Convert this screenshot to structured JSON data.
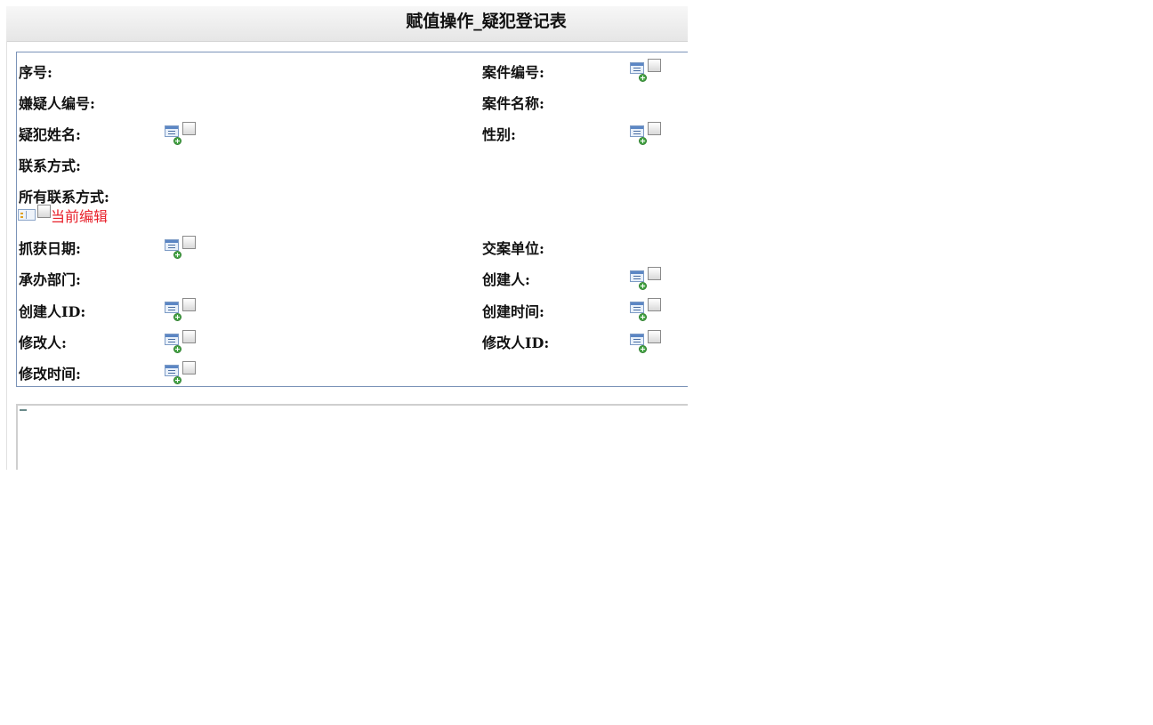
{
  "window": {
    "title": "赋值操作_疑犯登记表"
  },
  "form": {
    "fields": {
      "serial_no": "序号:",
      "case_no": "案件编号:",
      "suspect_no": "嫌疑人编号:",
      "case_name": "案件名称:",
      "suspect_name": "疑犯姓名:",
      "gender": "性别:",
      "contact": "联系方式:",
      "all_contacts": "所有联系方式:",
      "arrest_date": "抓获日期:",
      "handover_unit": "交案单位:",
      "handling_dept": "承办部门:",
      "creator": "创建人:",
      "creator_id": "创建人ID:",
      "create_time": "创建时间:",
      "modifier": "修改人:",
      "modifier_id": "修改人ID:",
      "modify_time": "修改时间:"
    },
    "current_edit_label": "当前编辑"
  },
  "icons": {
    "field_selector": "list-add-icon",
    "subtable": "grid-icon"
  },
  "colors": {
    "current_edit": "#e8202a",
    "form_border": "#7b93b8"
  }
}
